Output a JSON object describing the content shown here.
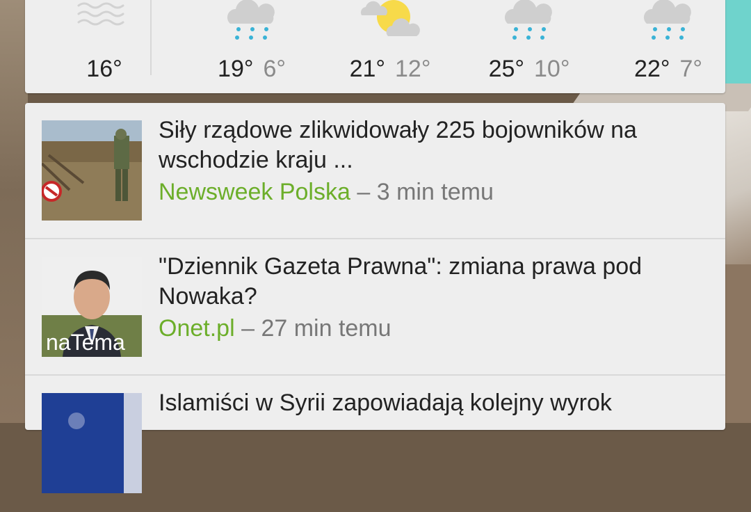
{
  "weather": {
    "days": [
      {
        "icon": "fog-icon",
        "high": "16°",
        "low": ""
      },
      {
        "icon": "rain-icon",
        "high": "19°",
        "low": "6°"
      },
      {
        "icon": "partly-cloudy-icon",
        "high": "21°",
        "low": "12°"
      },
      {
        "icon": "rain-icon",
        "high": "25°",
        "low": "10°"
      },
      {
        "icon": "rain-icon",
        "high": "22°",
        "low": "7°"
      }
    ]
  },
  "news": {
    "items": [
      {
        "headline": "Siły rządowe zlikwidowały 225 bojowników na wschodzie kraju ...",
        "source": "Newsweek Polska",
        "separator": "–",
        "time": "3 min temu",
        "thumb_overlay": ""
      },
      {
        "headline": "\"Dziennik Gazeta Prawna\": zmiana prawa pod Nowaka?",
        "source": "Onet.pl",
        "separator": "–",
        "time": "27 min temu",
        "thumb_overlay": "naTema"
      },
      {
        "headline": "Islamiści w Syrii zapowiadają kolejny wyrok",
        "source": "",
        "separator": "",
        "time": "",
        "thumb_overlay": ""
      }
    ]
  },
  "colors": {
    "source_green": "#6cae2a",
    "card_bg": "#eeeeee",
    "rain_drop": "#3ab3d6",
    "sun": "#f7da4a"
  }
}
